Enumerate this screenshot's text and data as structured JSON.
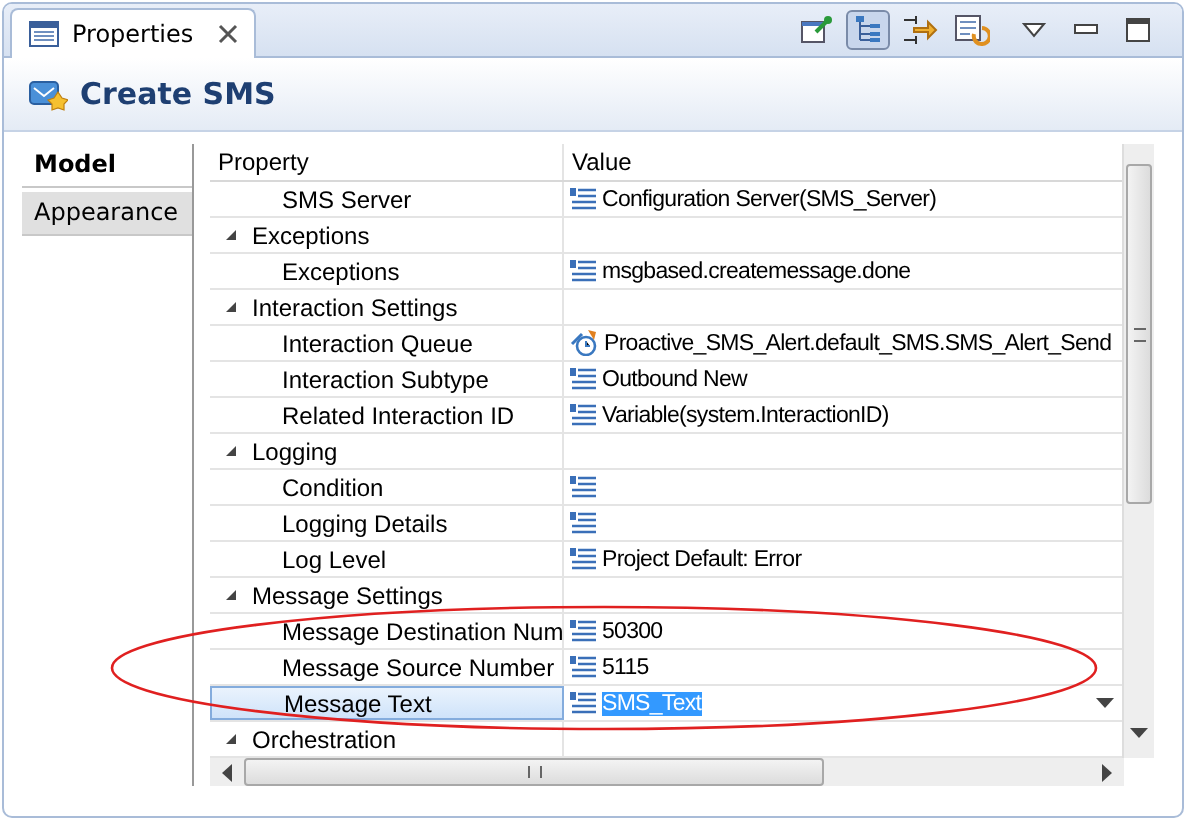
{
  "view_tab": {
    "label": "Properties",
    "selected": true
  },
  "toolbar": [
    {
      "kind": "pin",
      "selected": false
    },
    {
      "kind": "tree",
      "selected": true
    },
    {
      "kind": "filter",
      "selected": false
    },
    {
      "kind": "restore",
      "selected": false
    }
  ],
  "header": {
    "title": "Create SMS"
  },
  "side_tabs": [
    {
      "label": "Model",
      "selected": true
    },
    {
      "label": "Appearance",
      "selected": false
    }
  ],
  "table": {
    "columns": [
      "Property",
      "Value"
    ],
    "rows": [
      {
        "kind": "property",
        "label": "SMS Server",
        "value": {
          "kind": "list",
          "text": "Configuration Server(SMS_Server)"
        },
        "selected": false
      },
      {
        "kind": "group",
        "label": "Exceptions",
        "expanded": true,
        "children": [
          {
            "kind": "property",
            "label": "Exceptions",
            "value": {
              "kind": "list",
              "text": "msgbased.createmessage.done"
            },
            "selected": false
          }
        ]
      },
      {
        "kind": "group",
        "label": "Interaction Settings",
        "expanded": true,
        "children": [
          {
            "kind": "property",
            "label": "Interaction Queue",
            "value": {
              "kind": "queue",
              "text": "Proactive_SMS_Alert.default_SMS.SMS_Alert_Send"
            },
            "selected": false
          },
          {
            "kind": "property",
            "label": "Interaction Subtype",
            "value": {
              "kind": "list",
              "text": "Outbound New"
            },
            "selected": false
          },
          {
            "kind": "property",
            "label": "Related Interaction ID",
            "value": {
              "kind": "list",
              "text": "Variable(system.InteractionID)"
            },
            "selected": false
          }
        ]
      },
      {
        "kind": "group",
        "label": "Logging",
        "expanded": true,
        "children": [
          {
            "kind": "property",
            "label": "Condition",
            "value": {
              "kind": "list"
            },
            "selected": false
          },
          {
            "kind": "property",
            "label": "Logging Details",
            "value": {
              "kind": "list"
            },
            "selected": false
          },
          {
            "kind": "property",
            "label": "Log Level",
            "value": {
              "kind": "list",
              "text": "Project Default: Error"
            },
            "selected": false
          }
        ]
      },
      {
        "kind": "group",
        "label": "Message Settings",
        "expanded": true,
        "children": [
          {
            "kind": "property",
            "label": "Message Destination Num",
            "value": {
              "kind": "list",
              "text": "50300"
            },
            "selected": false
          },
          {
            "kind": "property",
            "label": "Message Source Number",
            "value": {
              "kind": "list",
              "text": "5115"
            },
            "selected": false
          },
          {
            "kind": "property",
            "label": "Message Text",
            "value": {
              "kind": "list",
              "text": "SMS_Text"
            },
            "selected": true
          }
        ]
      },
      {
        "kind": "group",
        "label": "Orchestration",
        "expanded": true,
        "children": []
      }
    ]
  }
}
